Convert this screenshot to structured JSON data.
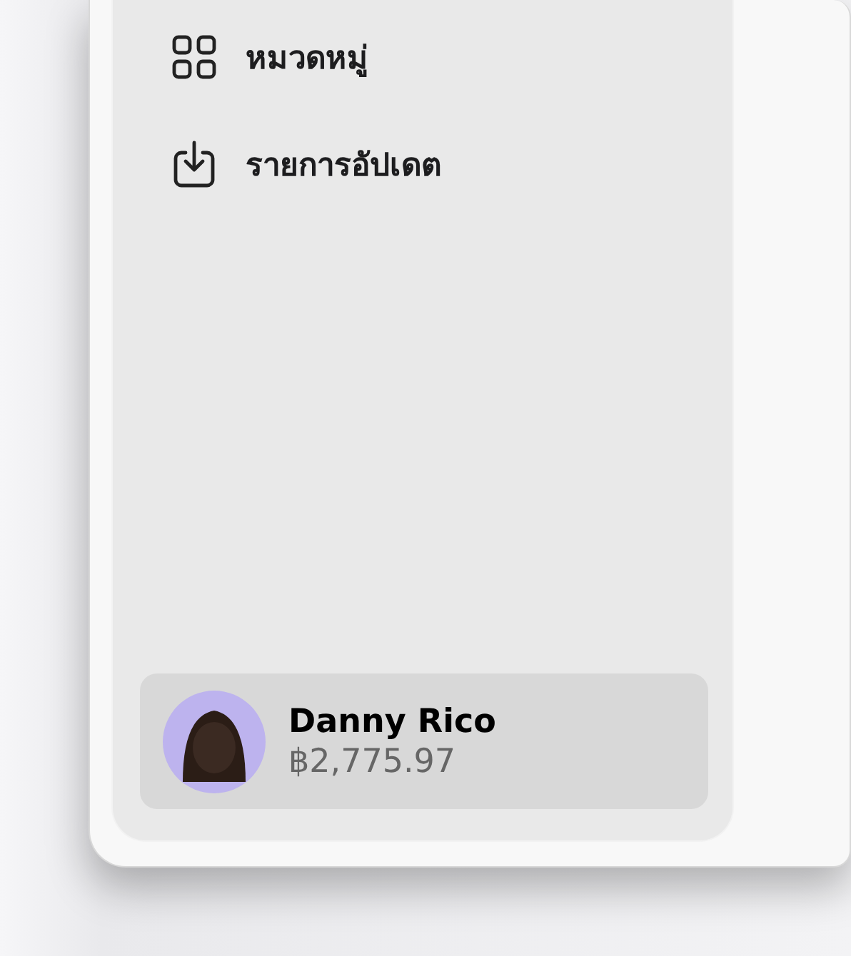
{
  "sidebar": {
    "items": [
      {
        "label": "หมวดหมู่"
      },
      {
        "label": "รายการอัปเดต"
      }
    ]
  },
  "account": {
    "name": "Danny Rico",
    "balance": "฿2,775.97"
  }
}
